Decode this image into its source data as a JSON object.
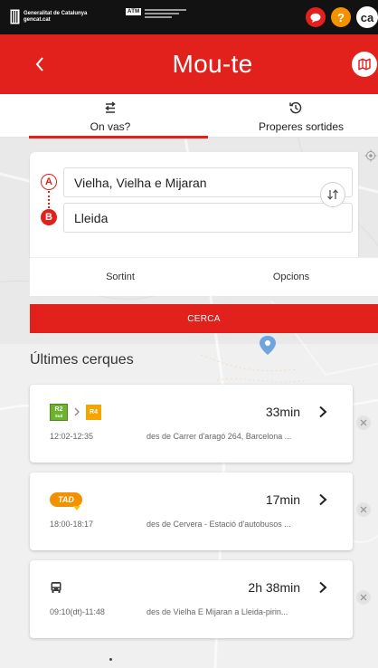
{
  "colors": {
    "primary_red": "#e2211c",
    "help_orange": "#f39200",
    "topbar_black": "#121212",
    "map_grey": "#e9e9e9",
    "r2_green": "#6cb22f",
    "r4_orange": "#f5a400",
    "tad_orange": "#f39200"
  },
  "topbar": {
    "gencat_name": "Generalitat de Catalunya",
    "gencat_url": "gencat.cat",
    "atm_label": "ATM",
    "chat_icon": "chat-bubble-icon",
    "help_label": "?",
    "language_label": "ca"
  },
  "header": {
    "back_icon": "chevron-left-icon",
    "title": "Mou-te",
    "map_icon": "map-icon"
  },
  "tabs": [
    {
      "label": "On vas?",
      "icon": "route-icon",
      "active": true
    },
    {
      "label": "Properes sortides",
      "icon": "history-icon",
      "active": false
    }
  ],
  "search": {
    "origin": {
      "marker": "A",
      "value": "Vielha, Vielha e Mijaran"
    },
    "destination": {
      "marker": "B",
      "value": "Lleida"
    },
    "swap_icon": "swap-vertical-icon",
    "locate_icon": "my-location-icon",
    "departure_label": "Sortint",
    "options_label": "Opcions",
    "submit_label": "CERCA"
  },
  "recent": {
    "heading": "Últimes cerques",
    "items": [
      {
        "legs": [
          {
            "line": "R2",
            "sub": "Sud"
          },
          {
            "line": "R4"
          }
        ],
        "duration": "33min",
        "times": "12:02-12:35",
        "description": "des de Carrer d'aragó 264, Barcelona ..."
      },
      {
        "legs": [
          {
            "line": "TAD"
          }
        ],
        "duration": "17min",
        "times": "18:00-18:17",
        "description": "des de Cervera - Estació d'autobusos ..."
      },
      {
        "legs": [
          {
            "mode_icon": "bus-icon"
          }
        ],
        "duration": "2h 38min",
        "times": "09:10(dt)-11:48",
        "description": "des de Vielha E Mijaran a Lleida-pirin..."
      }
    ]
  }
}
